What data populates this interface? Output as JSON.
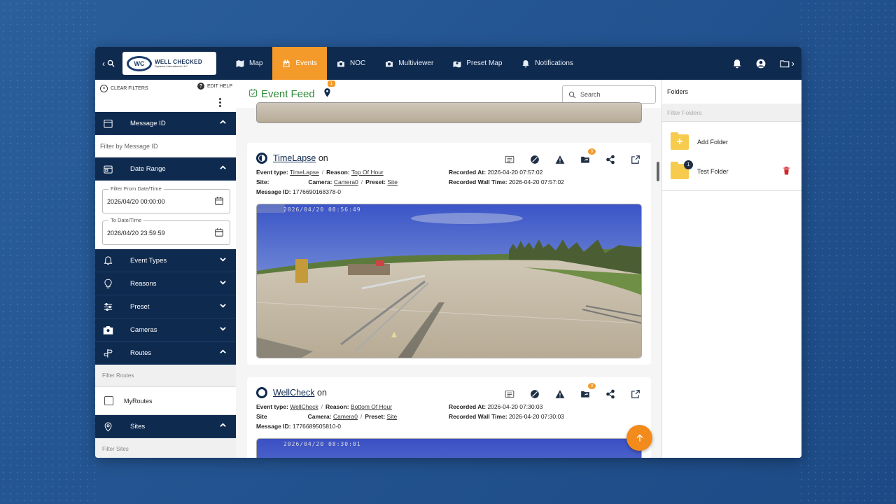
{
  "nav": {
    "logo_text": "WELL CHECKED",
    "logo_sub": "Systems International LLC",
    "items": [
      {
        "label": "Map",
        "icon": "map-icon"
      },
      {
        "label": "Events",
        "icon": "calendar-icon"
      },
      {
        "label": "NOC",
        "icon": "camera-icon"
      },
      {
        "label": "Multiviewer",
        "icon": "camera-icon"
      },
      {
        "label": "Preset Map",
        "icon": "map-marker-icon"
      },
      {
        "label": "Notifications",
        "icon": "bell-icon"
      }
    ],
    "active": "Events",
    "accent_color": "#f39a2a"
  },
  "sidebar": {
    "clear_filters": "CLEAR FILTERS",
    "edit_help": "EDIT HELP",
    "message_id": {
      "label": "Message ID",
      "placeholder": "Filter by Message ID"
    },
    "date_range": {
      "label": "Date Range",
      "from_label": "Filter From Date/Time",
      "from_value": "2026/04/20 00:00:00",
      "to_label": "To Date/Time",
      "to_value": "2026/04/20 23:59:59"
    },
    "event_types": "Event Types",
    "reasons": "Reasons",
    "preset": "Preset",
    "cameras": "Cameras",
    "routes": {
      "label": "Routes",
      "placeholder": "Filter Routes",
      "item": "MyRoutes"
    },
    "sites": {
      "label": "Sites",
      "placeholder": "Filter Sites"
    }
  },
  "feed": {
    "title": "Event Feed",
    "pin_badge": "1",
    "search_placeholder": "Search",
    "events": [
      {
        "name": "TimeLapse",
        "suffix": "on",
        "event_type": "TimeLapse",
        "reason": "Top Of Hour",
        "site_label": "Site:",
        "camera": "Camera0",
        "preset": "Site",
        "message_id": "1776690168378-0",
        "recorded_at": "2026-04-20 07:57:02",
        "recorded_wall_time": "2026-04-20 07:57:02",
        "share_badge": "0",
        "image_timestamp": "2026/04/20 08:56:49"
      },
      {
        "name": "WellCheck",
        "suffix": "on",
        "event_type": "WellCheck",
        "reason": "Bottom Of Hour",
        "site_label": "Site",
        "camera": "Camera0",
        "preset": "Site",
        "message_id": "1776689505810-0",
        "recorded_at": "2026-04-20 07:30:03",
        "recorded_wall_time": "2026-04-20 07:30:03",
        "share_badge": "0",
        "image_timestamp": "2026/04/20 08:30:01"
      }
    ],
    "labels": {
      "event_type": "Event type:",
      "reason": "Reason:",
      "camera": "Camera:",
      "preset": "Preset:",
      "message_id": "Message ID:",
      "recorded_at": "Recorded At:",
      "recorded_wall_time": "Recorded Wall Time:",
      "sep": "/"
    }
  },
  "folders": {
    "title": "Folders",
    "filter_placeholder": "Filter Folders",
    "items": [
      {
        "label": "Add Folder"
      },
      {
        "label": "Test Folder",
        "count": "1"
      }
    ]
  }
}
